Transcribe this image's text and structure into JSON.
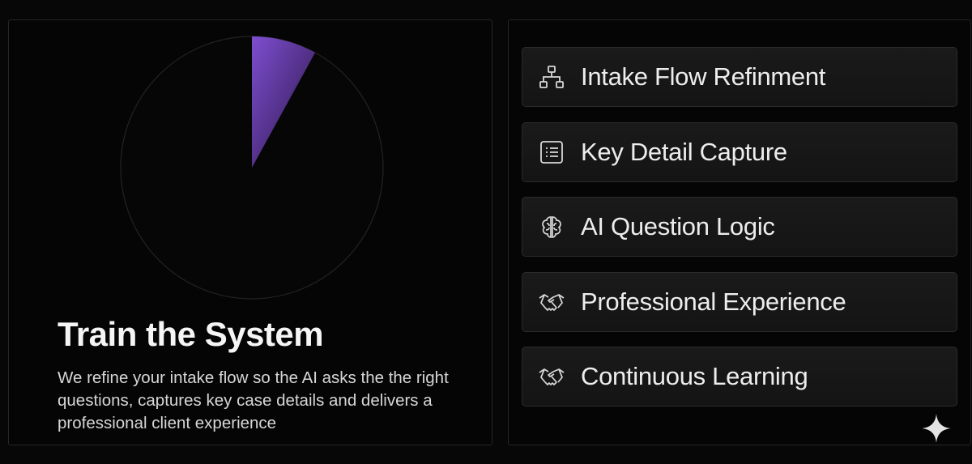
{
  "training": {
    "title": "Train the System",
    "description": "We refine your intake flow so the AI asks the the right questions, captures key case details and delivers a professional client experience",
    "progress": 0.08,
    "accent_color": "#7a4bc4"
  },
  "features": [
    {
      "label": "Intake Flow Refinment",
      "icon": "flowchart-icon"
    },
    {
      "label": "Key Detail Capture",
      "icon": "list-document-icon"
    },
    {
      "label": "AI Question Logic",
      "icon": "brain-icon"
    },
    {
      "label": "Professional Experience",
      "icon": "handshake-icon"
    },
    {
      "label": "Continuous Learning",
      "icon": "handshake-icon"
    }
  ],
  "colors": {
    "background": "#070707",
    "panel": "#050505",
    "card": "#171717",
    "text": "#ededed"
  },
  "watermark_icon": "sparkle-icon"
}
